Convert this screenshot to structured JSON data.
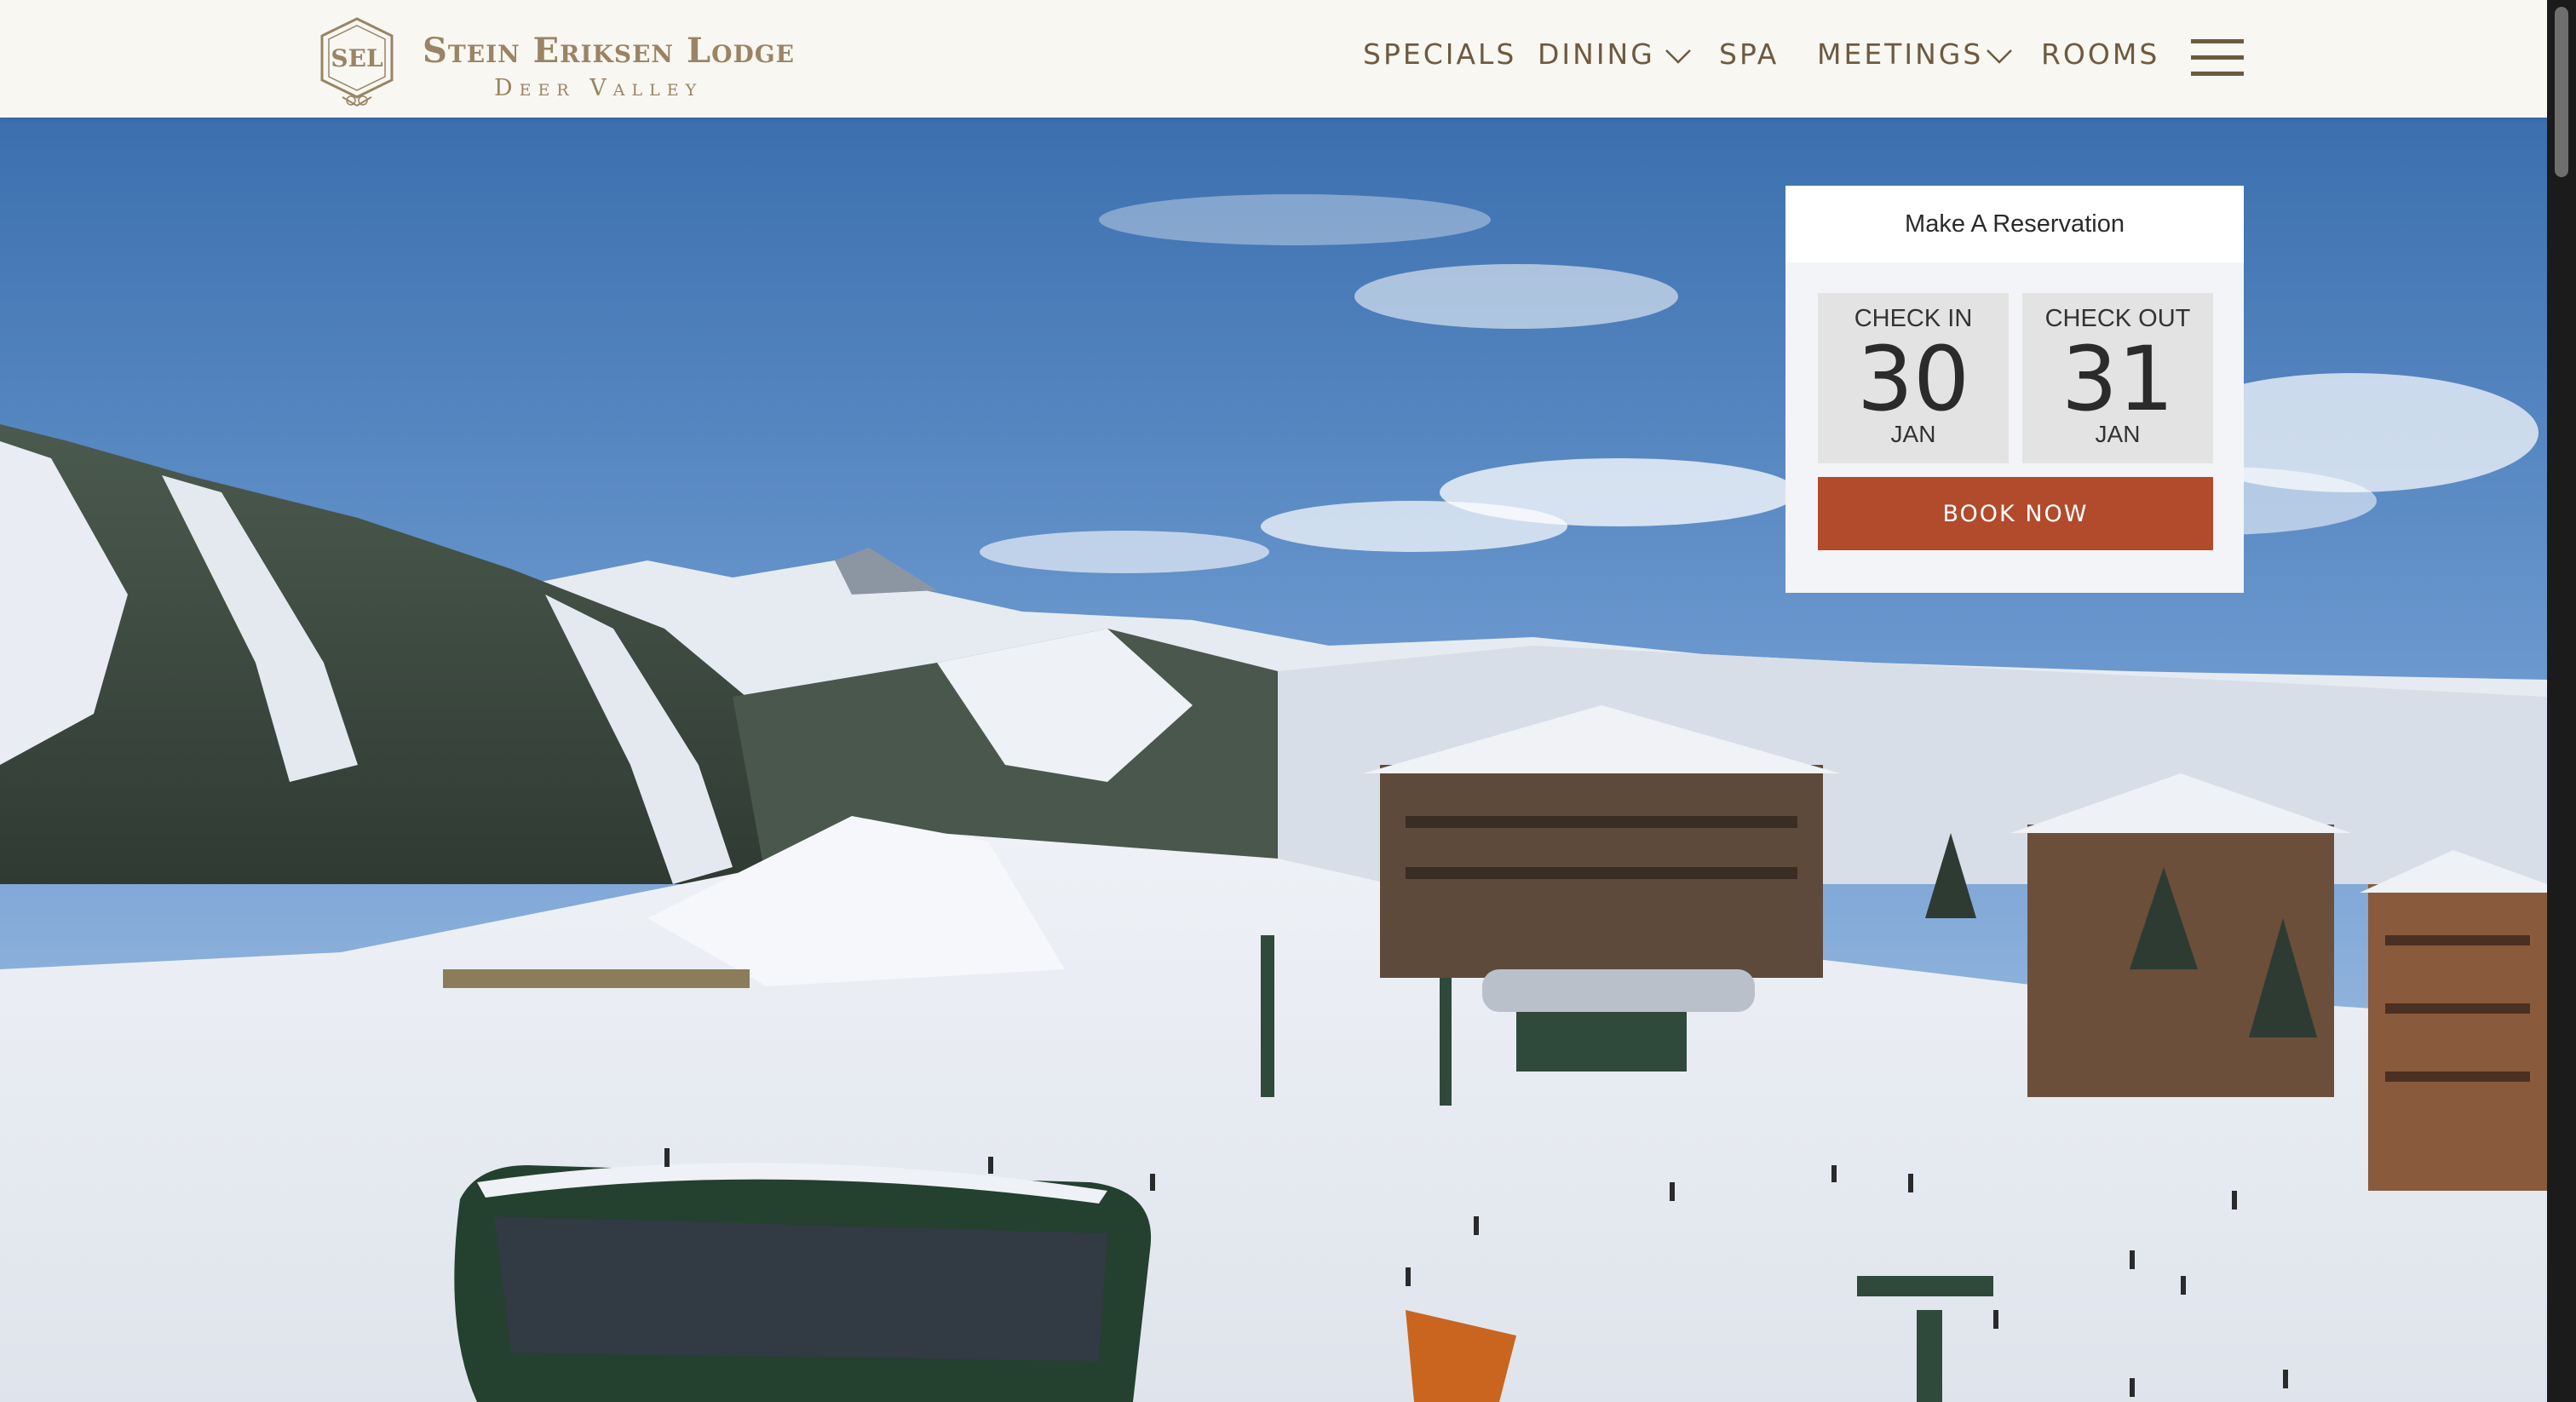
{
  "brand": {
    "name": "Stein Eriksen Lodge",
    "location": "Deer Valley",
    "monogram": "SEL",
    "color": "#9a8465"
  },
  "nav": {
    "items": [
      {
        "label": "SPECIALS",
        "has_dropdown": false
      },
      {
        "label": "DINING",
        "has_dropdown": true
      },
      {
        "label": "SPA",
        "has_dropdown": false
      },
      {
        "label": "MEETINGS",
        "has_dropdown": true
      },
      {
        "label": "ROOMS",
        "has_dropdown": false
      }
    ],
    "menu_icon": "hamburger-menu-icon",
    "text_color": "#6e5a40"
  },
  "hero": {
    "image": "snowy-ski-resort-with-chairlifts-and-lodge"
  },
  "reservation": {
    "title": "Make A Reservation",
    "check_in": {
      "label": "CHECK IN",
      "day": "30",
      "month": "JAN"
    },
    "check_out": {
      "label": "CHECK OUT",
      "day": "31",
      "month": "JAN"
    },
    "book_label": "BOOK NOW",
    "button_color": "#b24a2c"
  }
}
